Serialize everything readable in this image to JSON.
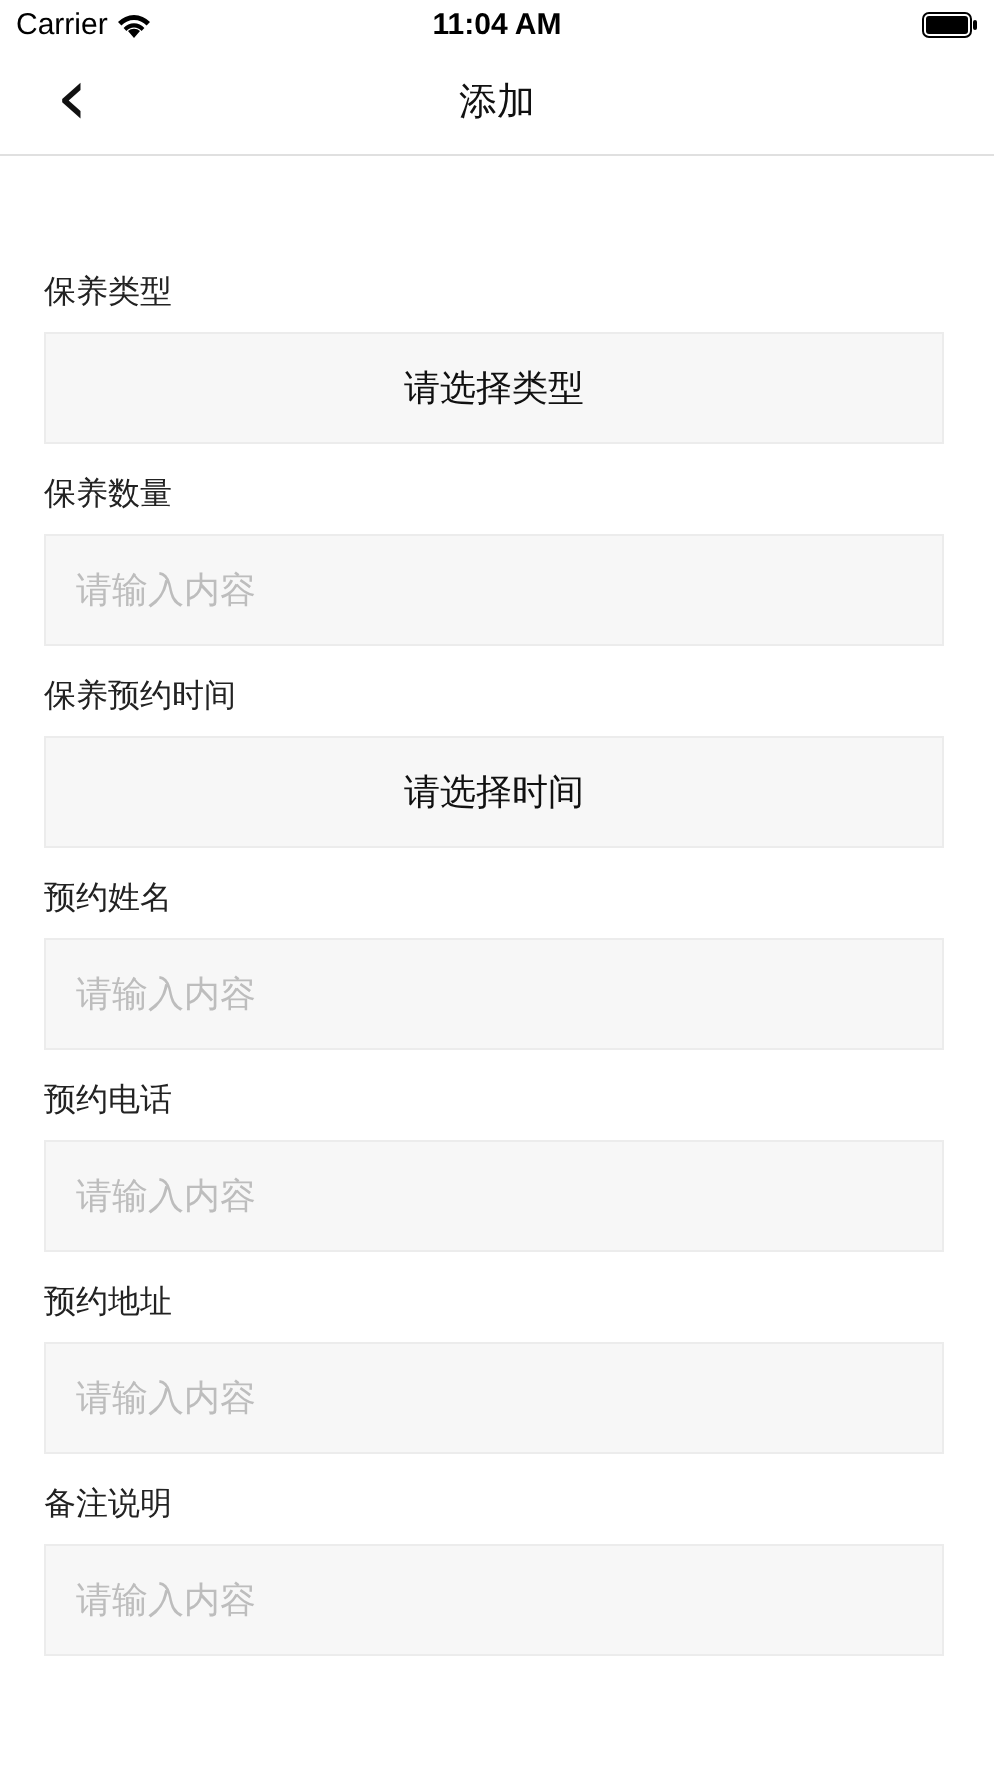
{
  "status_bar": {
    "carrier": "Carrier",
    "time": "11:04 AM"
  },
  "nav": {
    "back": "‹",
    "title": "添加"
  },
  "fields": [
    {
      "label": "保养类型",
      "kind": "picker",
      "value": "请选择类型"
    },
    {
      "label": "保养数量",
      "kind": "input",
      "placeholder": "请输入内容"
    },
    {
      "label": "保养预约时间",
      "kind": "picker",
      "value": "请选择时间"
    },
    {
      "label": "预约姓名",
      "kind": "input",
      "placeholder": "请输入内容"
    },
    {
      "label": "预约电话",
      "kind": "input",
      "placeholder": "请输入内容"
    },
    {
      "label": "预约地址",
      "kind": "input",
      "placeholder": "请输入内容"
    },
    {
      "label": "备注说明",
      "kind": "input",
      "placeholder": "请输入内容"
    }
  ]
}
